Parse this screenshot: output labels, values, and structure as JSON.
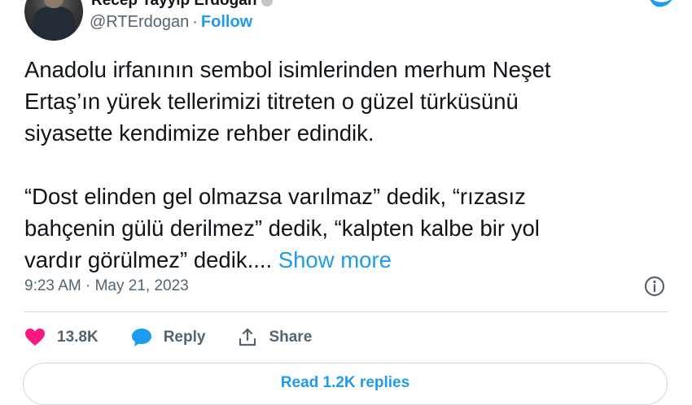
{
  "author": {
    "display_name": "Recep Tayyip Erdoğan",
    "handle": "@RTErdogan",
    "separator": "·",
    "follow_label": "Follow"
  },
  "tweet": {
    "paragraph_1": "Anadolu irfanının sembol isimlerinden merhum Neşet\nErtaş’ın yürek tellerimizi titreten o güzel türküsünü\nsiyasette kendimize rehber edindik.",
    "paragraph_2": "“Dost elinden gel olmazsa varılmaz” dedik, “rızasız\nbahçenin gülü derilmez” dedik, “kalpten kalbe bir yol\nvardır görülmez” dedik....",
    "show_more_label": "Show more"
  },
  "meta": {
    "timestamp": "9:23 AM · May 21, 2023"
  },
  "actions": {
    "like_count": "13.8K",
    "reply_label": "Reply",
    "share_label": "Share"
  },
  "replies_button": {
    "label": "Read 1.2K replies"
  },
  "colors": {
    "accent": "#1d9bf0",
    "like": "#f91880",
    "text": "#0f1419",
    "secondary": "#536471",
    "border": "#cfd9de"
  },
  "icons": {
    "logo": "twitter-bird-icon",
    "info": "info-icon",
    "like": "heart-icon",
    "reply": "speech-bubble-icon",
    "share": "share-upload-icon",
    "verified": "verified-badge-icon"
  }
}
